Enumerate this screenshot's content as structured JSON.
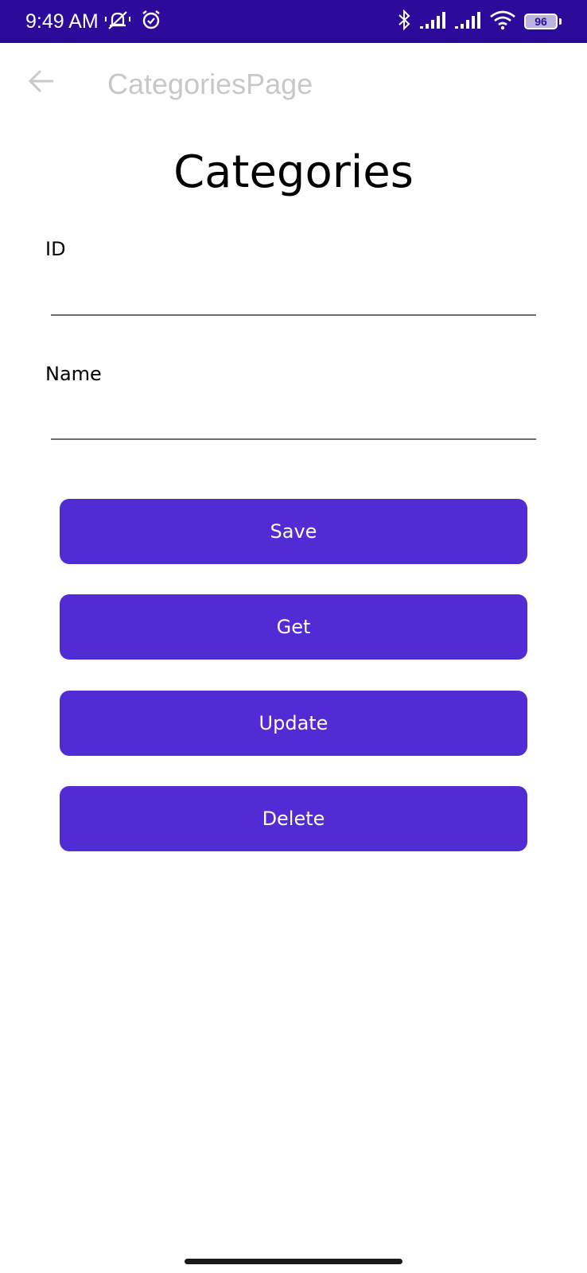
{
  "status_bar": {
    "time": "9:49 AM",
    "battery_level": "96",
    "background_color": "#2c0b9a",
    "left_icons": [
      "mute-bell-icon",
      "alarm-icon"
    ],
    "right_icons": [
      "bluetooth-icon",
      "signal-icon",
      "signal-icon",
      "wifi-icon",
      "battery-icon"
    ]
  },
  "nav_bar": {
    "back_icon": "back-arrow-icon",
    "title": "CategoriesPage"
  },
  "page": {
    "heading": "Categories",
    "fields": {
      "id": {
        "label": "ID",
        "value": "",
        "placeholder": ""
      },
      "name": {
        "label": "Name",
        "value": "",
        "placeholder": ""
      }
    },
    "buttons": {
      "save": "Save",
      "get": "Get",
      "update": "Update",
      "delete": "Delete"
    },
    "accent_color": "#512bd4"
  }
}
